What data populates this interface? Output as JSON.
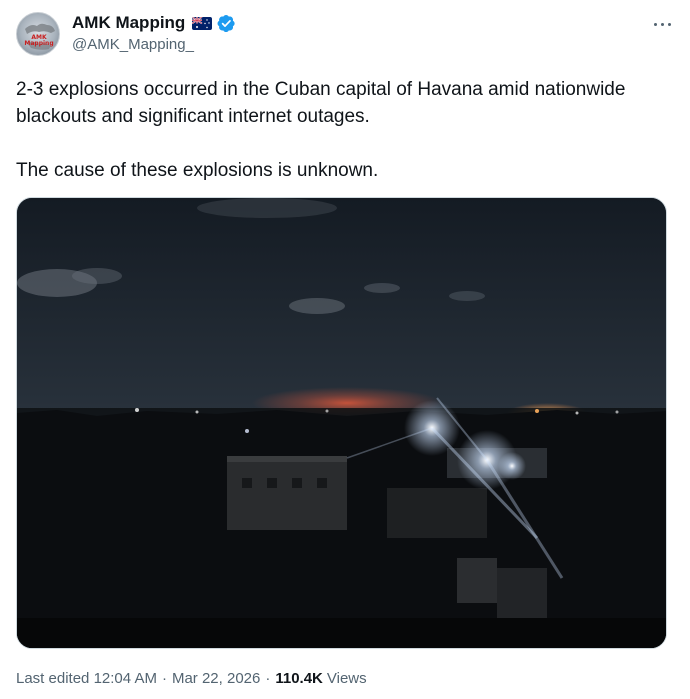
{
  "author": {
    "display_name": "AMK Mapping",
    "handle": "@AMK_Mapping_",
    "avatar_text": "AMK Mapping",
    "flag_icon": "australia-flag-icon",
    "verified_icon": "verified-badge-icon",
    "verified_color": "#1d9bf0"
  },
  "tweet": {
    "text": "2-3 explosions occurred in the Cuban capital of Havana amid nationwide blackouts and significant internet outages.\n\nThe cause of these explosions is unknown."
  },
  "footer": {
    "edited_label": "Last edited",
    "time": "12:04 AM",
    "separator": "·",
    "date": "Mar 22, 2026",
    "views_count": "110.4K",
    "views_label": "Views"
  },
  "colors": {
    "text_primary": "#0f1419",
    "text_secondary": "#536471",
    "border": "#cfd9de"
  }
}
